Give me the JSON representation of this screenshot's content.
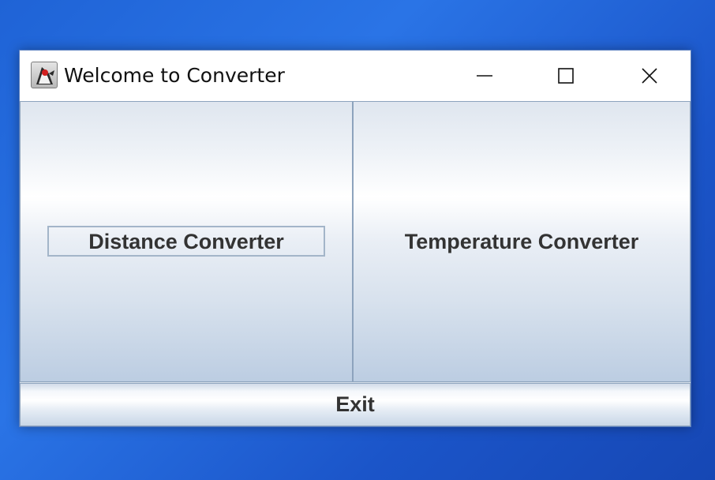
{
  "window": {
    "title": "Welcome to Converter",
    "app_icon": "java-duke-icon",
    "controls": {
      "minimize_icon": "minimize-icon",
      "maximize_icon": "maximize-icon",
      "close_icon": "close-icon"
    }
  },
  "buttons": {
    "distance": "Distance Converter",
    "temperature": "Temperature Converter",
    "exit": "Exit"
  },
  "colors": {
    "desktop": "#1f63d6",
    "button_text": "#333333",
    "button_border": "#8da3bd"
  }
}
